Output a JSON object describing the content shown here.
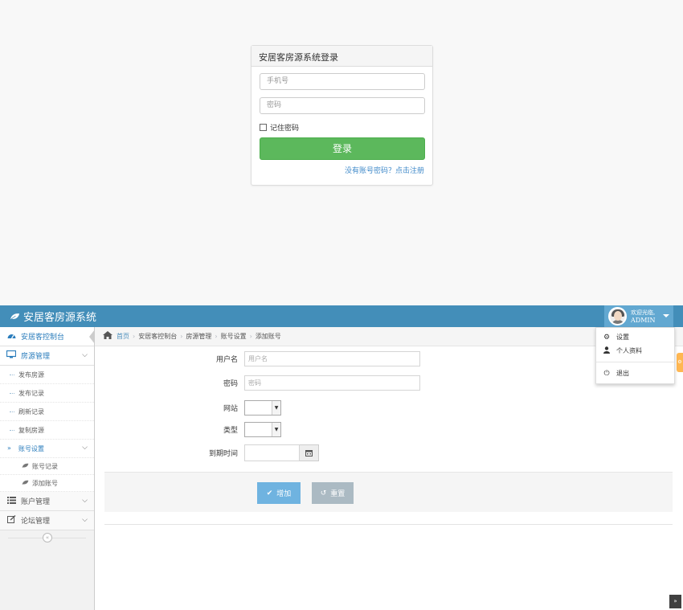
{
  "login": {
    "title": "安居客房源系统登录",
    "phone_placeholder": "手机号",
    "password_placeholder": "密码",
    "remember_label": "记住密码",
    "submit_label": "登录",
    "register_link": "没有账号密码？点击注册"
  },
  "navbar": {
    "brand": "安居客房源系统",
    "welcome": "欢迎光临,",
    "username": "ADMIN"
  },
  "user_menu": {
    "items": [
      {
        "label": "设置",
        "icon": "gear-icon"
      },
      {
        "label": "个人资料",
        "icon": "user-icon"
      },
      {
        "label": "退出",
        "icon": "power-icon"
      }
    ]
  },
  "sidebar": {
    "dashboard": "安居客控制台",
    "housing": "房源管理",
    "housing_items": [
      "发布房源",
      "发布记录",
      "刷新记录",
      "复制房源"
    ],
    "account_settings": "账号设置",
    "account_sub": [
      "账号记录",
      "添加账号"
    ],
    "account_manage": "账户管理",
    "forum_manage": "论坛管理",
    "collapse_icon": "«"
  },
  "breadcrumb": {
    "home": "首页",
    "items": [
      "安居客控制台",
      "房源管理",
      "账号设置",
      "添加账号"
    ]
  },
  "form": {
    "username_label": "用户名",
    "username_placeholder": "用户名",
    "password_label": "密码",
    "password_placeholder": "密码",
    "site_label": "网站",
    "type_label": "类型",
    "expire_label": "到期时间",
    "add_button": "增加",
    "reset_button": "重置"
  },
  "colors": {
    "navbar": "#438eb9",
    "login_button": "#5cb85c",
    "add_button": "#6fb3e0",
    "reset_button": "#abbac3",
    "link": "#428bca"
  }
}
